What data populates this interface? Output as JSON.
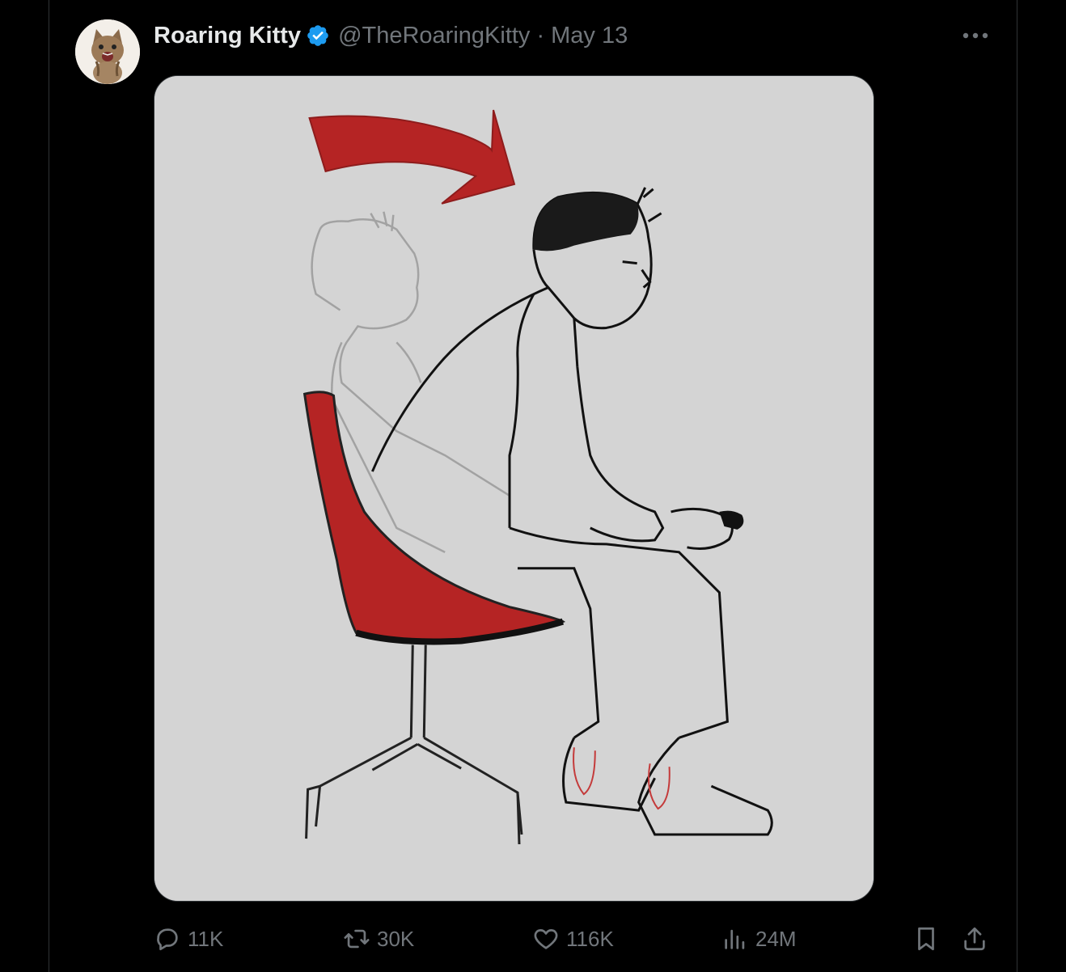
{
  "tweet": {
    "author_name": "Roaring Kitty",
    "verified_icon": "verified-badge-icon",
    "handle": "@TheRoaringKitty",
    "separator": "·",
    "date": "May 13",
    "more_icon": "more-horizontal-icon",
    "avatar_icon": "cat-avatar",
    "media_description_icon": "sketch-man-leaning-forward-in-red-chair"
  },
  "actions": {
    "reply": {
      "icon": "reply-icon",
      "count": "11K"
    },
    "repost": {
      "icon": "repost-icon",
      "count": "30K"
    },
    "like": {
      "icon": "heart-icon",
      "count": "116K"
    },
    "views": {
      "icon": "views-chart-icon",
      "count": "24M"
    },
    "bookmark": {
      "icon": "bookmark-icon"
    },
    "share": {
      "icon": "share-icon"
    }
  },
  "colors": {
    "background": "#000000",
    "text_primary": "#e7e9ea",
    "text_muted": "#71767b",
    "verified_blue": "#1d9bf0",
    "border": "#2f3336",
    "sketch_bg": "#d4d4d4",
    "sketch_red": "#b52424"
  }
}
